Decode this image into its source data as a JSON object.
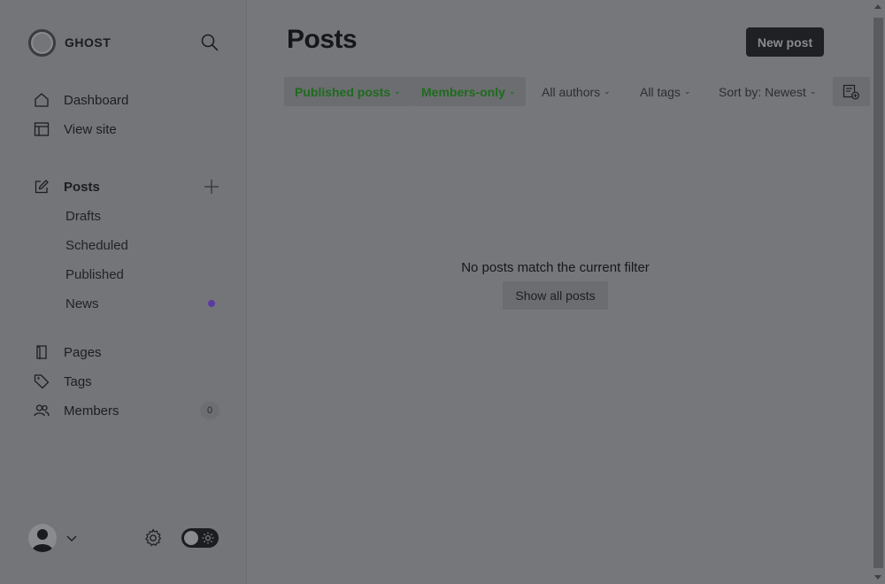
{
  "brand": {
    "name": "GHOST",
    "icon": "ghost-logo-icon"
  },
  "sidebar": {
    "nav": [
      {
        "label": "Dashboard",
        "icon": "home-icon"
      },
      {
        "label": "View site",
        "icon": "layout-icon"
      }
    ],
    "posts": {
      "label": "Posts",
      "icon": "edit-icon"
    },
    "sub_items": [
      {
        "label": "Drafts"
      },
      {
        "label": "Scheduled"
      },
      {
        "label": "Published"
      },
      {
        "label": "News"
      }
    ],
    "nav2": [
      {
        "label": "Pages",
        "icon": "page-icon"
      },
      {
        "label": "Tags",
        "icon": "tag-icon"
      },
      {
        "label": "Members",
        "icon": "members-icon",
        "count": "0"
      }
    ]
  },
  "main": {
    "title": "Posts",
    "new_post_label": "New post",
    "filters": [
      {
        "label": "Published posts",
        "active": true
      },
      {
        "label": "Members-only",
        "active": true
      },
      {
        "label": "All authors",
        "active": false
      },
      {
        "label": "All tags",
        "active": false
      },
      {
        "label": "Sort by: Newest",
        "active": false
      }
    ],
    "empty_message": "No posts match the current filter",
    "show_all_label": "Show all posts"
  },
  "colors": {
    "accent_green": "#1e6b1e",
    "news_dot": "#5b3aa3",
    "overlay_bg": "#76777a"
  }
}
